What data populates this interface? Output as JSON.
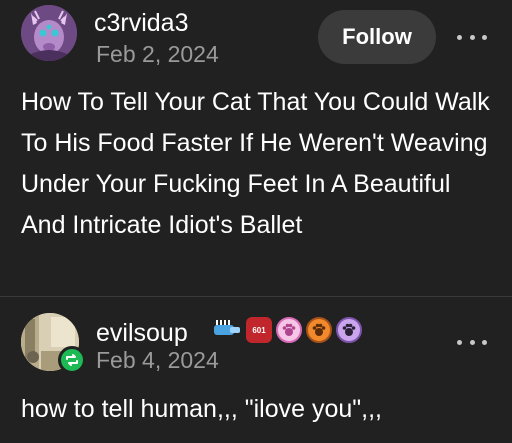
{
  "posts": [
    {
      "username": "c3rvida3",
      "date": "Feb 2, 2024",
      "follow_label": "Follow",
      "body": "How To Tell Your Cat That You Could Walk To His Food Faster If He Weren't Weaving Under Your Fucking Feet In A Beautiful And Intricate Idiot's Ballet"
    },
    {
      "username": "evilsoup",
      "date": "Feb 4, 2024",
      "body": "how to tell human,,, \"ilove you\",,,",
      "badges": [
        {
          "icon": "toothbrush-badge-icon"
        },
        {
          "icon": "hexagon-badge-icon",
          "text": "601"
        },
        {
          "icon": "pink-paw-badge-icon"
        },
        {
          "icon": "orange-paw-badge-icon"
        },
        {
          "icon": "purple-paw-badge-icon"
        }
      ]
    }
  ],
  "colors": {
    "background": "#212121",
    "text": "#ffffff",
    "muted": "#9a9a9a",
    "button": "#3b3b3b",
    "reblog": "#1db954"
  }
}
